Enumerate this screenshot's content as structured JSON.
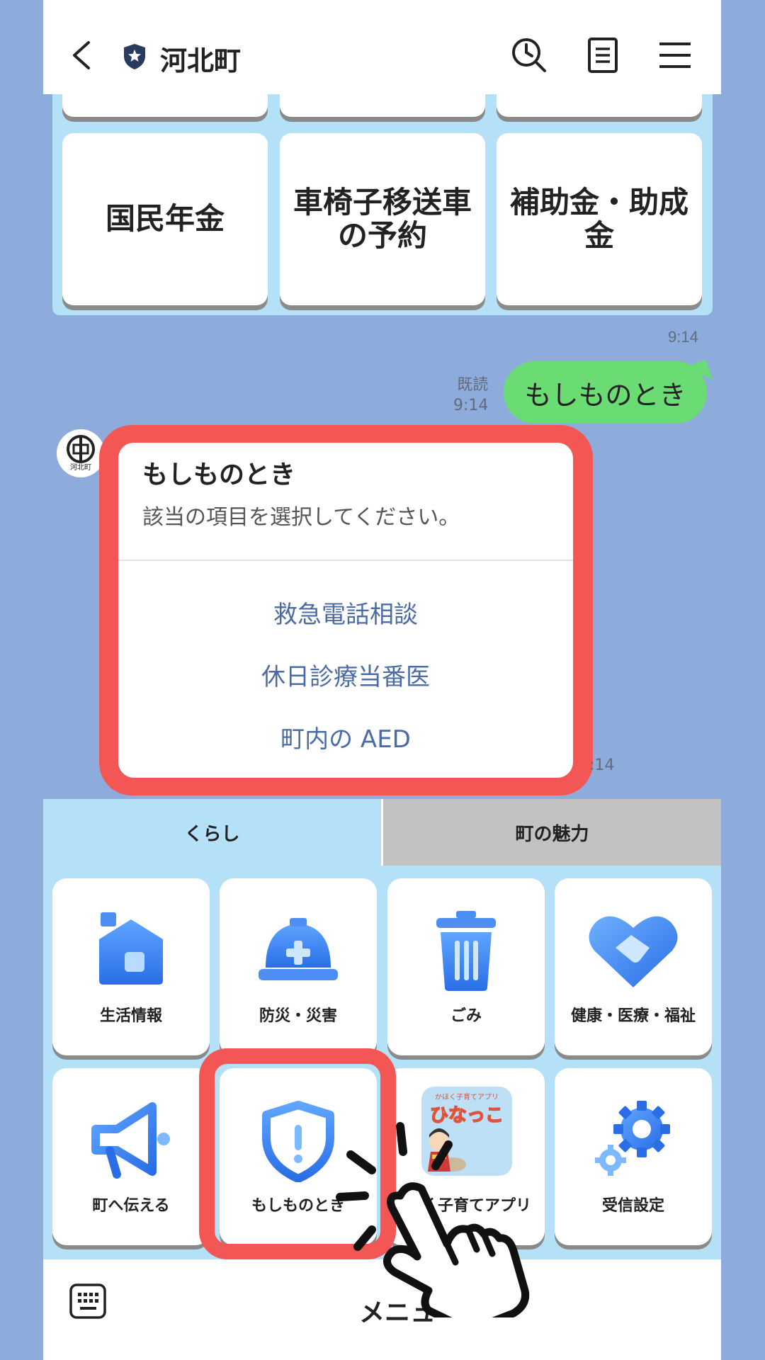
{
  "header": {
    "title": "河北町"
  },
  "top_tiles": [
    "国民年金",
    "車椅子移送車\nの予約",
    "補助金・助成金"
  ],
  "chat": {
    "time_top": "9:14",
    "read_label": "既読",
    "read_time": "9:14",
    "user_message": "もしものとき",
    "avatar_label": "河北町",
    "time_cut": ":14"
  },
  "popup": {
    "title": "もしものとき",
    "subtitle": "該当の項目を選択してください。",
    "items": [
      "救急電話相談",
      "休日診療当番医",
      "町内の AED"
    ]
  },
  "rich_menu": {
    "tabs": [
      "くらし",
      "町の魅力"
    ],
    "items": [
      "生活情報",
      "防災・災害",
      "ごみ",
      "健康・医療・福祉",
      "町へ伝える",
      "もしものとき",
      "く子育てアプリ",
      "受信設定"
    ],
    "app_badge_top": "かほく子育てアプリ",
    "app_badge_title": "ひなっこ"
  },
  "bottom": {
    "menu_label": "メニュー"
  },
  "colors": {
    "background": "#8eacdb",
    "menu_bg": "#b5e1f8",
    "highlight": "#f25756",
    "green_bubble": "#6bdc73",
    "link": "#4b6ba7"
  }
}
